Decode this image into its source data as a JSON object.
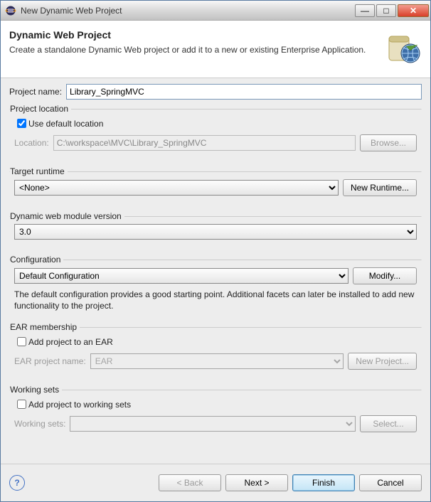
{
  "window": {
    "title": "New Dynamic Web Project"
  },
  "banner": {
    "heading": "Dynamic Web Project",
    "sub": "Create a standalone Dynamic Web project or add it to a new or existing Enterprise Application."
  },
  "project_name": {
    "label": "Project name:",
    "value": "Library_SpringMVC"
  },
  "location": {
    "legend": "Project location",
    "use_default_label": "Use default location",
    "use_default_checked": true,
    "location_label": "Location:",
    "location_value": "C:\\workspace\\MVC\\Library_SpringMVC",
    "browse": "Browse..."
  },
  "runtime": {
    "legend": "Target runtime",
    "value": "<None>",
    "new_btn": "New Runtime..."
  },
  "dwm": {
    "legend": "Dynamic web module version",
    "value": "3.0"
  },
  "config": {
    "legend": "Configuration",
    "value": "Default Configuration",
    "modify": "Modify...",
    "desc": "The default configuration provides a good starting point. Additional facets can later be installed to add new functionality to the project."
  },
  "ear": {
    "legend": "EAR membership",
    "add_label": "Add project to an EAR",
    "add_checked": false,
    "name_label": "EAR project name:",
    "name_value": "EAR",
    "new_btn": "New Project..."
  },
  "ws": {
    "legend": "Working sets",
    "add_label": "Add project to working sets",
    "add_checked": false,
    "name_label": "Working sets:",
    "select_btn": "Select..."
  },
  "footer": {
    "back": "< Back",
    "next": "Next >",
    "finish": "Finish",
    "cancel": "Cancel"
  }
}
